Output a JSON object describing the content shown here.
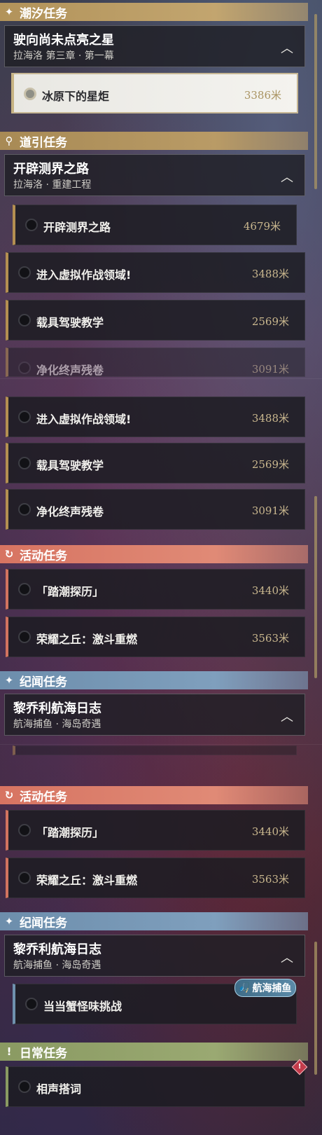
{
  "sections": {
    "tide": "潮汐任务",
    "guide": "道引任务",
    "event": "活动任务",
    "lore": "纪闻任务",
    "daily": "日常任务"
  },
  "groups": {
    "tide_main": {
      "title": "驶向尚未点亮之星",
      "subtitle": "拉海洛 第三章 · 第一幕"
    },
    "guide_main": {
      "title": "开辟测界之路",
      "subtitle": "拉海洛 · 重建工程"
    },
    "lore_main": {
      "title": "黎乔利航海日志",
      "subtitle": "航海捕鱼 · 海岛奇遇"
    }
  },
  "tasks": {
    "t1": {
      "name": "冰原下的星炬",
      "distance": "3386米"
    },
    "t2": {
      "name": "开辟测界之路",
      "distance": "4679米"
    },
    "t3": {
      "name": "进入虚拟作战领域!",
      "distance": "3488米"
    },
    "t4": {
      "name": "载具驾驶教学",
      "distance": "2569米"
    },
    "t5": {
      "name": "净化终声残卷",
      "distance": "3091米"
    },
    "t6": {
      "name": "「踏潮探历」",
      "distance": "3440米"
    },
    "t7": {
      "name": "荣耀之丘：激斗重燃",
      "distance": "3563米"
    },
    "t8": {
      "name": "当当蟹怪味挑战",
      "distance": ""
    },
    "t9": {
      "name": "相声搭词",
      "distance": ""
    }
  },
  "badge": {
    "label": "航海捕鱼",
    "icon": "fishing-icon"
  },
  "colors": {
    "tide": "#b2935a",
    "event": "#d77462",
    "lore": "#6d8eac",
    "daily": "#8a9a62",
    "distance": "#c9b78e"
  }
}
